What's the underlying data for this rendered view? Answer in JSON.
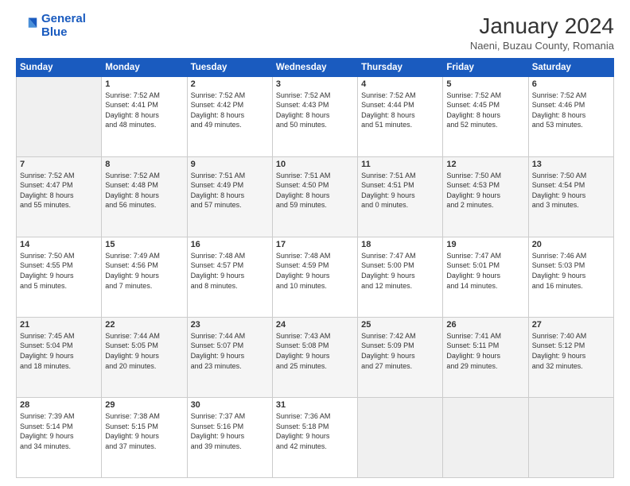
{
  "header": {
    "logo_line1": "General",
    "logo_line2": "Blue",
    "title": "January 2024",
    "subtitle": "Naeni, Buzau County, Romania"
  },
  "weekdays": [
    "Sunday",
    "Monday",
    "Tuesday",
    "Wednesday",
    "Thursday",
    "Friday",
    "Saturday"
  ],
  "weeks": [
    [
      {
        "num": "",
        "info": ""
      },
      {
        "num": "1",
        "info": "Sunrise: 7:52 AM\nSunset: 4:41 PM\nDaylight: 8 hours\nand 48 minutes."
      },
      {
        "num": "2",
        "info": "Sunrise: 7:52 AM\nSunset: 4:42 PM\nDaylight: 8 hours\nand 49 minutes."
      },
      {
        "num": "3",
        "info": "Sunrise: 7:52 AM\nSunset: 4:43 PM\nDaylight: 8 hours\nand 50 minutes."
      },
      {
        "num": "4",
        "info": "Sunrise: 7:52 AM\nSunset: 4:44 PM\nDaylight: 8 hours\nand 51 minutes."
      },
      {
        "num": "5",
        "info": "Sunrise: 7:52 AM\nSunset: 4:45 PM\nDaylight: 8 hours\nand 52 minutes."
      },
      {
        "num": "6",
        "info": "Sunrise: 7:52 AM\nSunset: 4:46 PM\nDaylight: 8 hours\nand 53 minutes."
      }
    ],
    [
      {
        "num": "7",
        "info": "Sunrise: 7:52 AM\nSunset: 4:47 PM\nDaylight: 8 hours\nand 55 minutes."
      },
      {
        "num": "8",
        "info": "Sunrise: 7:52 AM\nSunset: 4:48 PM\nDaylight: 8 hours\nand 56 minutes."
      },
      {
        "num": "9",
        "info": "Sunrise: 7:51 AM\nSunset: 4:49 PM\nDaylight: 8 hours\nand 57 minutes."
      },
      {
        "num": "10",
        "info": "Sunrise: 7:51 AM\nSunset: 4:50 PM\nDaylight: 8 hours\nand 59 minutes."
      },
      {
        "num": "11",
        "info": "Sunrise: 7:51 AM\nSunset: 4:51 PM\nDaylight: 9 hours\nand 0 minutes."
      },
      {
        "num": "12",
        "info": "Sunrise: 7:50 AM\nSunset: 4:53 PM\nDaylight: 9 hours\nand 2 minutes."
      },
      {
        "num": "13",
        "info": "Sunrise: 7:50 AM\nSunset: 4:54 PM\nDaylight: 9 hours\nand 3 minutes."
      }
    ],
    [
      {
        "num": "14",
        "info": "Sunrise: 7:50 AM\nSunset: 4:55 PM\nDaylight: 9 hours\nand 5 minutes."
      },
      {
        "num": "15",
        "info": "Sunrise: 7:49 AM\nSunset: 4:56 PM\nDaylight: 9 hours\nand 7 minutes."
      },
      {
        "num": "16",
        "info": "Sunrise: 7:48 AM\nSunset: 4:57 PM\nDaylight: 9 hours\nand 8 minutes."
      },
      {
        "num": "17",
        "info": "Sunrise: 7:48 AM\nSunset: 4:59 PM\nDaylight: 9 hours\nand 10 minutes."
      },
      {
        "num": "18",
        "info": "Sunrise: 7:47 AM\nSunset: 5:00 PM\nDaylight: 9 hours\nand 12 minutes."
      },
      {
        "num": "19",
        "info": "Sunrise: 7:47 AM\nSunset: 5:01 PM\nDaylight: 9 hours\nand 14 minutes."
      },
      {
        "num": "20",
        "info": "Sunrise: 7:46 AM\nSunset: 5:03 PM\nDaylight: 9 hours\nand 16 minutes."
      }
    ],
    [
      {
        "num": "21",
        "info": "Sunrise: 7:45 AM\nSunset: 5:04 PM\nDaylight: 9 hours\nand 18 minutes."
      },
      {
        "num": "22",
        "info": "Sunrise: 7:44 AM\nSunset: 5:05 PM\nDaylight: 9 hours\nand 20 minutes."
      },
      {
        "num": "23",
        "info": "Sunrise: 7:44 AM\nSunset: 5:07 PM\nDaylight: 9 hours\nand 23 minutes."
      },
      {
        "num": "24",
        "info": "Sunrise: 7:43 AM\nSunset: 5:08 PM\nDaylight: 9 hours\nand 25 minutes."
      },
      {
        "num": "25",
        "info": "Sunrise: 7:42 AM\nSunset: 5:09 PM\nDaylight: 9 hours\nand 27 minutes."
      },
      {
        "num": "26",
        "info": "Sunrise: 7:41 AM\nSunset: 5:11 PM\nDaylight: 9 hours\nand 29 minutes."
      },
      {
        "num": "27",
        "info": "Sunrise: 7:40 AM\nSunset: 5:12 PM\nDaylight: 9 hours\nand 32 minutes."
      }
    ],
    [
      {
        "num": "28",
        "info": "Sunrise: 7:39 AM\nSunset: 5:14 PM\nDaylight: 9 hours\nand 34 minutes."
      },
      {
        "num": "29",
        "info": "Sunrise: 7:38 AM\nSunset: 5:15 PM\nDaylight: 9 hours\nand 37 minutes."
      },
      {
        "num": "30",
        "info": "Sunrise: 7:37 AM\nSunset: 5:16 PM\nDaylight: 9 hours\nand 39 minutes."
      },
      {
        "num": "31",
        "info": "Sunrise: 7:36 AM\nSunset: 5:18 PM\nDaylight: 9 hours\nand 42 minutes."
      },
      {
        "num": "",
        "info": ""
      },
      {
        "num": "",
        "info": ""
      },
      {
        "num": "",
        "info": ""
      }
    ]
  ]
}
